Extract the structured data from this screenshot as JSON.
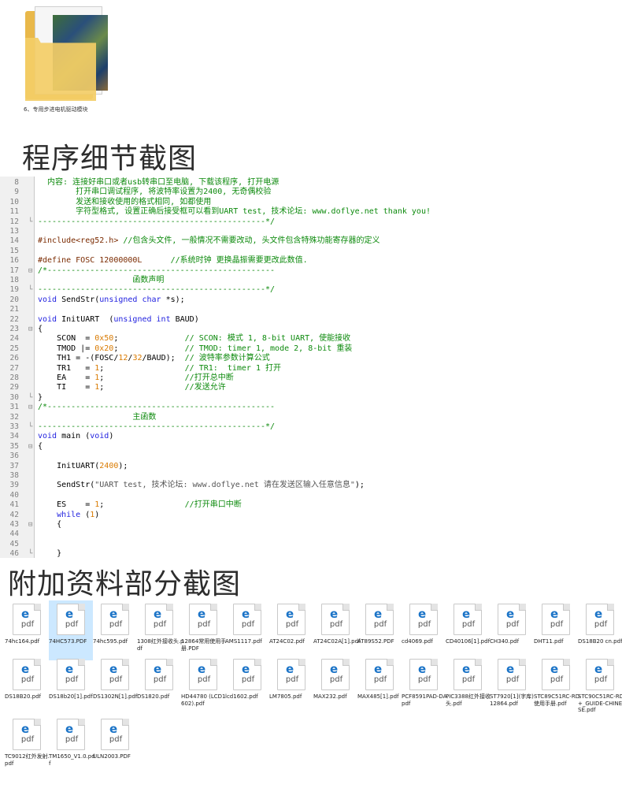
{
  "folder": {
    "label": "6、专用步进电机驱动模块"
  },
  "section_titles": {
    "code_details": "程序细节截图",
    "attachments": "附加资料部分截图"
  },
  "code_lines": [
    {
      "ln": "8",
      "fold": "",
      "parts": [
        {
          "t": "  内容: 连接好串口或者usb转串口至电脑, 下载该程序, 打开电源",
          "c": "cmt"
        }
      ]
    },
    {
      "ln": "9",
      "fold": "",
      "parts": [
        {
          "t": "        打开串口调试程序, 将波特率设置为2400, 无奇偶校验",
          "c": "cmt"
        }
      ]
    },
    {
      "ln": "10",
      "fold": "",
      "parts": [
        {
          "t": "        发送和接收使用的格式相同, 如都使用",
          "c": "cmt"
        }
      ]
    },
    {
      "ln": "11",
      "fold": "",
      "parts": [
        {
          "t": "        字符型格式, 设置正确后接受框可以看到UART test, 技术论坛: www.doflye.net thank you!",
          "c": "cmt"
        }
      ]
    },
    {
      "ln": "12",
      "fold": "L",
      "parts": [
        {
          "t": "------------------------------------------------*/",
          "c": "cmt"
        }
      ]
    },
    {
      "ln": "13",
      "fold": "",
      "parts": []
    },
    {
      "ln": "14",
      "fold": "",
      "parts": [
        {
          "t": "#include<reg52.h>",
          "c": "pp"
        },
        {
          "t": " //包含头文件, 一般情况不需要改动, 头文件包含特殊功能寄存器的定义",
          "c": "cmt"
        }
      ]
    },
    {
      "ln": "15",
      "fold": "",
      "parts": []
    },
    {
      "ln": "16",
      "fold": "",
      "parts": [
        {
          "t": "#define FOSC 12000000L",
          "c": "pp"
        },
        {
          "t": "      //系统时钟 更换晶振需要更改此数值.",
          "c": "cmt"
        }
      ]
    },
    {
      "ln": "17",
      "fold": "-",
      "parts": [
        {
          "t": "/*------------------------------------------------",
          "c": "cmt"
        }
      ]
    },
    {
      "ln": "18",
      "fold": "",
      "parts": [
        {
          "t": "                    函数声明",
          "c": "cmt"
        }
      ]
    },
    {
      "ln": "19",
      "fold": "L",
      "parts": [
        {
          "t": "------------------------------------------------*/",
          "c": "cmt"
        }
      ]
    },
    {
      "ln": "20",
      "fold": "",
      "parts": [
        {
          "t": "void",
          "c": "kw"
        },
        {
          "t": " SendStr(",
          "c": ""
        },
        {
          "t": "unsigned char",
          "c": "kw"
        },
        {
          "t": " *s);",
          "c": ""
        }
      ]
    },
    {
      "ln": "21",
      "fold": "",
      "parts": []
    },
    {
      "ln": "22",
      "fold": "",
      "parts": [
        {
          "t": "void",
          "c": "kw"
        },
        {
          "t": " InitUART  (",
          "c": ""
        },
        {
          "t": "unsigned int",
          "c": "kw"
        },
        {
          "t": " BAUD)",
          "c": ""
        }
      ]
    },
    {
      "ln": "23",
      "fold": "-",
      "parts": [
        {
          "t": "{",
          "c": ""
        }
      ]
    },
    {
      "ln": "24",
      "fold": "",
      "parts": [
        {
          "t": "    SCON  = ",
          "c": ""
        },
        {
          "t": "0x50",
          "c": "num"
        },
        {
          "t": ";              ",
          "c": ""
        },
        {
          "t": "// SCON: 模式 1, 8-bit UART, 使能接收",
          "c": "cmt"
        }
      ]
    },
    {
      "ln": "25",
      "fold": "",
      "parts": [
        {
          "t": "    TMOD |= ",
          "c": ""
        },
        {
          "t": "0x20",
          "c": "num"
        },
        {
          "t": ";              ",
          "c": ""
        },
        {
          "t": "// TMOD: timer 1, mode 2, 8-bit 重装",
          "c": "cmt"
        }
      ]
    },
    {
      "ln": "26",
      "fold": "",
      "parts": [
        {
          "t": "    TH1 = -(FOSC/",
          "c": ""
        },
        {
          "t": "12",
          "c": "num"
        },
        {
          "t": "/",
          "c": ""
        },
        {
          "t": "32",
          "c": "num"
        },
        {
          "t": "/BAUD);  ",
          "c": ""
        },
        {
          "t": "// 波特率参数计算公式",
          "c": "cmt"
        }
      ]
    },
    {
      "ln": "27",
      "fold": "",
      "parts": [
        {
          "t": "    TR1   = ",
          "c": ""
        },
        {
          "t": "1",
          "c": "num"
        },
        {
          "t": ";                 ",
          "c": ""
        },
        {
          "t": "// TR1:  timer 1 打开",
          "c": "cmt"
        }
      ]
    },
    {
      "ln": "28",
      "fold": "",
      "parts": [
        {
          "t": "    EA    = ",
          "c": ""
        },
        {
          "t": "1",
          "c": "num"
        },
        {
          "t": ";                 ",
          "c": ""
        },
        {
          "t": "//打开总中断",
          "c": "cmt"
        }
      ]
    },
    {
      "ln": "29",
      "fold": "",
      "parts": [
        {
          "t": "    TI    = ",
          "c": ""
        },
        {
          "t": "1",
          "c": "num"
        },
        {
          "t": ";                 ",
          "c": ""
        },
        {
          "t": "//发送允许",
          "c": "cmt"
        }
      ]
    },
    {
      "ln": "30",
      "fold": "L",
      "parts": [
        {
          "t": "}",
          "c": ""
        }
      ]
    },
    {
      "ln": "31",
      "fold": "-",
      "parts": [
        {
          "t": "/*------------------------------------------------",
          "c": "cmt"
        }
      ]
    },
    {
      "ln": "32",
      "fold": "",
      "parts": [
        {
          "t": "                    主函数",
          "c": "cmt"
        }
      ]
    },
    {
      "ln": "33",
      "fold": "L",
      "parts": [
        {
          "t": "------------------------------------------------*/",
          "c": "cmt"
        }
      ]
    },
    {
      "ln": "34",
      "fold": "",
      "parts": [
        {
          "t": "void",
          "c": "kw"
        },
        {
          "t": " main (",
          "c": ""
        },
        {
          "t": "void",
          "c": "kw"
        },
        {
          "t": ")",
          "c": ""
        }
      ]
    },
    {
      "ln": "35",
      "fold": "-",
      "parts": [
        {
          "t": "{",
          "c": ""
        }
      ]
    },
    {
      "ln": "36",
      "fold": "",
      "parts": []
    },
    {
      "ln": "37",
      "fold": "",
      "parts": [
        {
          "t": "    InitUART(",
          "c": ""
        },
        {
          "t": "2400",
          "c": "num"
        },
        {
          "t": ");",
          "c": ""
        }
      ]
    },
    {
      "ln": "38",
      "fold": "",
      "parts": []
    },
    {
      "ln": "39",
      "fold": "",
      "parts": [
        {
          "t": "    SendStr(",
          "c": ""
        },
        {
          "t": "\"UART test, 技术论坛: www.doflye.net 请在发送区输入任意信息\"",
          "c": "str"
        },
        {
          "t": ");",
          "c": ""
        }
      ]
    },
    {
      "ln": "40",
      "fold": "",
      "parts": []
    },
    {
      "ln": "41",
      "fold": "",
      "parts": [
        {
          "t": "    ES    = ",
          "c": ""
        },
        {
          "t": "1",
          "c": "num"
        },
        {
          "t": ";                 ",
          "c": ""
        },
        {
          "t": "//打开串口中断",
          "c": "cmt"
        }
      ]
    },
    {
      "ln": "42",
      "fold": "",
      "parts": [
        {
          "t": "    ",
          "c": ""
        },
        {
          "t": "while",
          "c": "kw"
        },
        {
          "t": " (",
          "c": ""
        },
        {
          "t": "1",
          "c": "num"
        },
        {
          "t": ")",
          "c": ""
        }
      ]
    },
    {
      "ln": "43",
      "fold": "-",
      "parts": [
        {
          "t": "    {",
          "c": ""
        }
      ]
    },
    {
      "ln": "44",
      "fold": "",
      "parts": []
    },
    {
      "ln": "45",
      "fold": "",
      "parts": []
    },
    {
      "ln": "46",
      "fold": "L",
      "parts": [
        {
          "t": "    }",
          "c": ""
        }
      ]
    },
    {
      "ln": "47",
      "fold": "",
      "parts": [
        {
          "t": "}",
          "c": ""
        }
      ]
    }
  ],
  "files": [
    {
      "name": "74hc164.pdf",
      "selected": false
    },
    {
      "name": "74HC573.PDF",
      "selected": true
    },
    {
      "name": "74hc595.pdf",
      "selected": false
    },
    {
      "name": "1308红外接收头.pdf",
      "selected": false
    },
    {
      "name": "12864常用使用手册.PDF",
      "selected": false
    },
    {
      "name": "AMS1117.pdf",
      "selected": false
    },
    {
      "name": "AT24C02.pdf",
      "selected": false
    },
    {
      "name": "AT24C02A[1].pdf",
      "selected": false
    },
    {
      "name": "AT89S52.PDF",
      "selected": false
    },
    {
      "name": "cd4069.pdf",
      "selected": false
    },
    {
      "name": "CD40106[1].pdf",
      "selected": false
    },
    {
      "name": "CH340.pdf",
      "selected": false
    },
    {
      "name": "DHT11.pdf",
      "selected": false
    },
    {
      "name": "DS18B20 cn.pdf",
      "selected": false
    },
    {
      "name": "DS18B20.pdf",
      "selected": false
    },
    {
      "name": "DS18b20[1].pdf",
      "selected": false
    },
    {
      "name": "DS1302N[1].pdf",
      "selected": false
    },
    {
      "name": "DS1820.pdf",
      "selected": false
    },
    {
      "name": "HD44780 (LCD1602).pdf",
      "selected": false
    },
    {
      "name": "lcd1602.pdf",
      "selected": false
    },
    {
      "name": "LM7805.pdf",
      "selected": false
    },
    {
      "name": "MAX232.pdf",
      "selected": false
    },
    {
      "name": "MAX485[1].pdf",
      "selected": false
    },
    {
      "name": "PCF8591PAD-DA.pdf",
      "selected": false
    },
    {
      "name": "PIC3388红外接收头.pdf",
      "selected": false
    },
    {
      "name": "ST7920[1](字库)12864.pdf",
      "selected": false
    },
    {
      "name": "STC89C51RC-RD使用手册.pdf",
      "selected": false
    },
    {
      "name": "STC90C51RC-RD+_GUIDE-CHINESE.pdf",
      "selected": false
    },
    {
      "name": "TC9012红外发射.pdf",
      "selected": false
    },
    {
      "name": "TM1650_V1.0.pdf",
      "selected": false
    },
    {
      "name": "ULN2003.PDF",
      "selected": false
    }
  ],
  "file_icon": {
    "badge": "e",
    "type_label": "pdf",
    "icon": "edge-pdf-icon"
  },
  "colors": {
    "comment": "#0d8a0d",
    "keyword": "#1f1fdf",
    "number": "#d97a00",
    "selected_bg": "#cce8ff",
    "folder": "#f3cd66"
  }
}
